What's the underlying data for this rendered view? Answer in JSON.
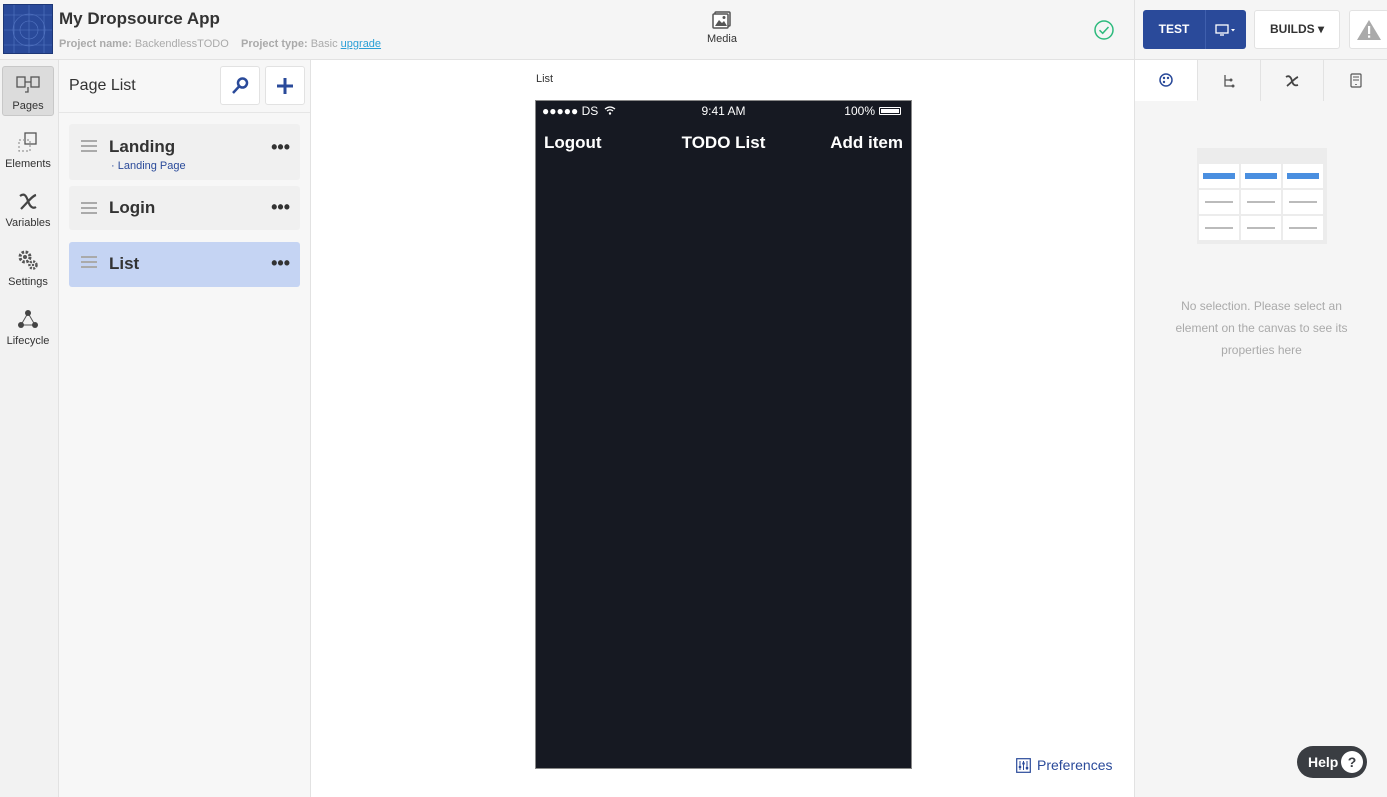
{
  "header": {
    "app_title": "My Dropsource App",
    "project_name_label": "Project name:",
    "project_name": "BackendlessTODO",
    "project_type_label": "Project type:",
    "project_type": "Basic",
    "upgrade_label": "upgrade",
    "media_label": "Media",
    "test_label": "TEST",
    "builds_label": "BUILDS ▾",
    "status_icon": "check-circle-icon",
    "status_color": "#2dba7d",
    "accent_color": "#2a4a9a"
  },
  "leftnav": {
    "items": [
      {
        "label": "Pages",
        "icon": "pages-icon",
        "active": true
      },
      {
        "label": "Elements",
        "icon": "elements-icon"
      },
      {
        "label": "Variables",
        "icon": "variables-icon"
      },
      {
        "label": "Settings",
        "icon": "settings-icon"
      },
      {
        "label": "Lifecycle",
        "icon": "lifecycle-icon"
      }
    ]
  },
  "pagelist": {
    "title": "Page List",
    "pages": [
      {
        "name": "Landing",
        "subtitle": "· Landing Page"
      },
      {
        "name": "Login"
      },
      {
        "name": "List",
        "selected": true
      }
    ],
    "more_glyph": "•••"
  },
  "canvas": {
    "page_label": "List",
    "phone": {
      "signal": "●●●●● DS",
      "time": "9:41 AM",
      "battery": "100%",
      "nav_left": "Logout",
      "nav_title": "TODO List",
      "nav_right": "Add item"
    },
    "preferences_label": "Preferences"
  },
  "rightpanel": {
    "tabs": [
      "palette-icon",
      "tree-icon",
      "variable-icon",
      "device-icon"
    ],
    "no_selection_text": "No selection. Please select an element on the canvas to see its properties here"
  },
  "help": {
    "label": "Help",
    "glyph": "?"
  }
}
